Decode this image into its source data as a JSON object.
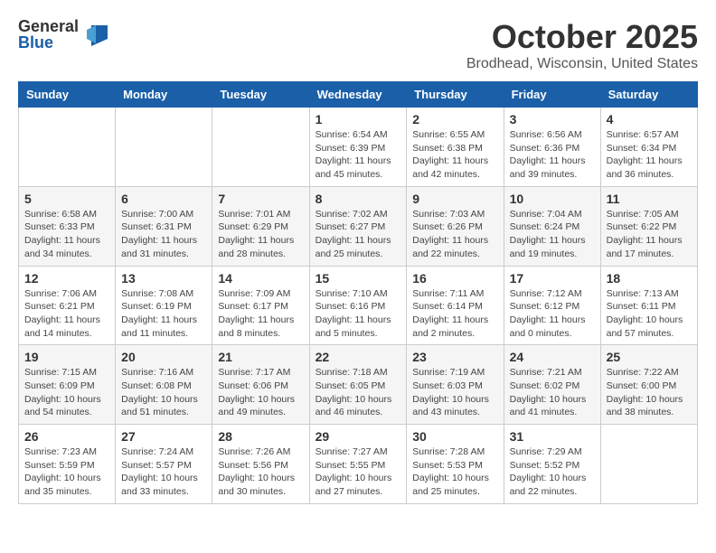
{
  "logo": {
    "general": "General",
    "blue": "Blue"
  },
  "title": "October 2025",
  "location": "Brodhead, Wisconsin, United States",
  "days_header": [
    "Sunday",
    "Monday",
    "Tuesday",
    "Wednesday",
    "Thursday",
    "Friday",
    "Saturday"
  ],
  "weeks": [
    [
      {
        "day": "",
        "info": ""
      },
      {
        "day": "",
        "info": ""
      },
      {
        "day": "",
        "info": ""
      },
      {
        "day": "1",
        "info": "Sunrise: 6:54 AM\nSunset: 6:39 PM\nDaylight: 11 hours\nand 45 minutes."
      },
      {
        "day": "2",
        "info": "Sunrise: 6:55 AM\nSunset: 6:38 PM\nDaylight: 11 hours\nand 42 minutes."
      },
      {
        "day": "3",
        "info": "Sunrise: 6:56 AM\nSunset: 6:36 PM\nDaylight: 11 hours\nand 39 minutes."
      },
      {
        "day": "4",
        "info": "Sunrise: 6:57 AM\nSunset: 6:34 PM\nDaylight: 11 hours\nand 36 minutes."
      }
    ],
    [
      {
        "day": "5",
        "info": "Sunrise: 6:58 AM\nSunset: 6:33 PM\nDaylight: 11 hours\nand 34 minutes."
      },
      {
        "day": "6",
        "info": "Sunrise: 7:00 AM\nSunset: 6:31 PM\nDaylight: 11 hours\nand 31 minutes."
      },
      {
        "day": "7",
        "info": "Sunrise: 7:01 AM\nSunset: 6:29 PM\nDaylight: 11 hours\nand 28 minutes."
      },
      {
        "day": "8",
        "info": "Sunrise: 7:02 AM\nSunset: 6:27 PM\nDaylight: 11 hours\nand 25 minutes."
      },
      {
        "day": "9",
        "info": "Sunrise: 7:03 AM\nSunset: 6:26 PM\nDaylight: 11 hours\nand 22 minutes."
      },
      {
        "day": "10",
        "info": "Sunrise: 7:04 AM\nSunset: 6:24 PM\nDaylight: 11 hours\nand 19 minutes."
      },
      {
        "day": "11",
        "info": "Sunrise: 7:05 AM\nSunset: 6:22 PM\nDaylight: 11 hours\nand 17 minutes."
      }
    ],
    [
      {
        "day": "12",
        "info": "Sunrise: 7:06 AM\nSunset: 6:21 PM\nDaylight: 11 hours\nand 14 minutes."
      },
      {
        "day": "13",
        "info": "Sunrise: 7:08 AM\nSunset: 6:19 PM\nDaylight: 11 hours\nand 11 minutes."
      },
      {
        "day": "14",
        "info": "Sunrise: 7:09 AM\nSunset: 6:17 PM\nDaylight: 11 hours\nand 8 minutes."
      },
      {
        "day": "15",
        "info": "Sunrise: 7:10 AM\nSunset: 6:16 PM\nDaylight: 11 hours\nand 5 minutes."
      },
      {
        "day": "16",
        "info": "Sunrise: 7:11 AM\nSunset: 6:14 PM\nDaylight: 11 hours\nand 2 minutes."
      },
      {
        "day": "17",
        "info": "Sunrise: 7:12 AM\nSunset: 6:12 PM\nDaylight: 11 hours\nand 0 minutes."
      },
      {
        "day": "18",
        "info": "Sunrise: 7:13 AM\nSunset: 6:11 PM\nDaylight: 10 hours\nand 57 minutes."
      }
    ],
    [
      {
        "day": "19",
        "info": "Sunrise: 7:15 AM\nSunset: 6:09 PM\nDaylight: 10 hours\nand 54 minutes."
      },
      {
        "day": "20",
        "info": "Sunrise: 7:16 AM\nSunset: 6:08 PM\nDaylight: 10 hours\nand 51 minutes."
      },
      {
        "day": "21",
        "info": "Sunrise: 7:17 AM\nSunset: 6:06 PM\nDaylight: 10 hours\nand 49 minutes."
      },
      {
        "day": "22",
        "info": "Sunrise: 7:18 AM\nSunset: 6:05 PM\nDaylight: 10 hours\nand 46 minutes."
      },
      {
        "day": "23",
        "info": "Sunrise: 7:19 AM\nSunset: 6:03 PM\nDaylight: 10 hours\nand 43 minutes."
      },
      {
        "day": "24",
        "info": "Sunrise: 7:21 AM\nSunset: 6:02 PM\nDaylight: 10 hours\nand 41 minutes."
      },
      {
        "day": "25",
        "info": "Sunrise: 7:22 AM\nSunset: 6:00 PM\nDaylight: 10 hours\nand 38 minutes."
      }
    ],
    [
      {
        "day": "26",
        "info": "Sunrise: 7:23 AM\nSunset: 5:59 PM\nDaylight: 10 hours\nand 35 minutes."
      },
      {
        "day": "27",
        "info": "Sunrise: 7:24 AM\nSunset: 5:57 PM\nDaylight: 10 hours\nand 33 minutes."
      },
      {
        "day": "28",
        "info": "Sunrise: 7:26 AM\nSunset: 5:56 PM\nDaylight: 10 hours\nand 30 minutes."
      },
      {
        "day": "29",
        "info": "Sunrise: 7:27 AM\nSunset: 5:55 PM\nDaylight: 10 hours\nand 27 minutes."
      },
      {
        "day": "30",
        "info": "Sunrise: 7:28 AM\nSunset: 5:53 PM\nDaylight: 10 hours\nand 25 minutes."
      },
      {
        "day": "31",
        "info": "Sunrise: 7:29 AM\nSunset: 5:52 PM\nDaylight: 10 hours\nand 22 minutes."
      },
      {
        "day": "",
        "info": ""
      }
    ]
  ]
}
